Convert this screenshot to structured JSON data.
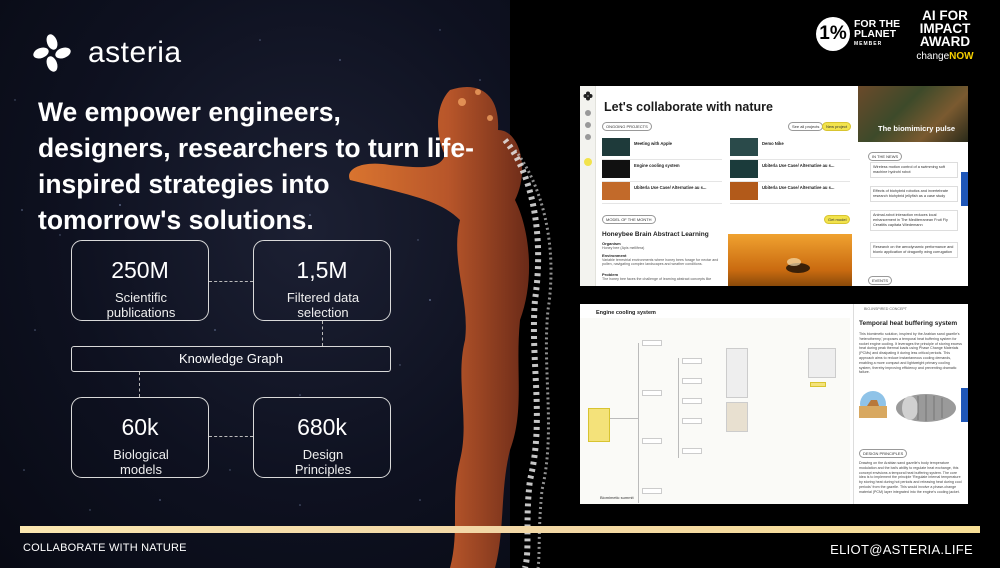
{
  "brand": {
    "name": "asteria"
  },
  "headline": "We empower engineers, designers, researchers to turn life-inspired strategies into tomorrow's solutions.",
  "stats": [
    {
      "value": "250M",
      "label": "Scientific publications"
    },
    {
      "value": "1,5M",
      "label": "Filtered data selection"
    },
    {
      "value": "60k",
      "label": "Biological models"
    },
    {
      "value": "680k",
      "label": "Design Principles"
    }
  ],
  "knowledge_graph": "Knowledge Graph",
  "badges": {
    "one_percent": {
      "mark": "1%",
      "line1": "FOR THE",
      "line2": "PLANET",
      "member": "MEMBER"
    },
    "award": {
      "line1": "AI FOR",
      "line2": "IMPACT",
      "line3": "AWARD",
      "change": "change",
      "now": "NOW"
    }
  },
  "screenshot1": {
    "title": "Let's collaborate with nature",
    "section_projects": "ONGOING PROJECTS",
    "see_all": "See all projects",
    "new_project": "New project",
    "projects": [
      "Meeting with Apple",
      "Demo Nike",
      "Engine cooling system",
      "Ubiterla Use Case/ Alternative au s...",
      "Ubiterla Use Case/ Alternative au s...",
      "Ubiterla Use Case/ Alternative au s..."
    ],
    "pulse": "The biomimicry pulse",
    "section_model": "MODEL OF THE MONTH",
    "get_model": "Get model",
    "model_title": "Honeybee Brain Abstract Learning",
    "model_sections": [
      "Organism",
      "Environment",
      "Problem"
    ],
    "model_texts": [
      "Honey bee (Apis mellifera)",
      "Variable terrestrial environments where honey bees forage for nectar and pollen, navigating complex landscapes and weather conditions.",
      "The honey bee faces the challenge of learning abstract concepts like"
    ],
    "section_news": "IN THE NEWS",
    "news": [
      "Wireless motion control of a swimming soft machine hydrohl robot",
      "Effects of biohybrid robotics and invertebrate research biohybrid jellyfish as a case study",
      "Animal-robot interaction reduces local enhancement in The Mediterranean Fruit Fly Ceratitis capitata Wiedemann",
      "Research on the aerodynamic performance and bionic application of dragonfly wing corrugation"
    ],
    "section_events": "EVENTS"
  },
  "screenshot2": {
    "title": "Engine cooling system",
    "panel_tag": "BIO-INSPIRED CONCEPT",
    "panel_title": "Temporal heat buffering system",
    "panel_text": "This biomimetic solution, inspired by the Arabian sand gazelle's 'heterothermy,' proposes a temporal heat buffering system for rocket engine cooling. It leverages the principle of storing excess heat during peak thermal loads using Phase Change Materials (PCMs) and dissipating it during less critical periods. This approach aims to reduce instantaneous cooling demands, enabling a more compact and lightweight primary cooling system, thereby improving efficiency and preventing dramatic failure.",
    "section_design": "DESIGN PRINCIPLES",
    "design_text": "Drawing on the Arabian sand gazelle's body temperature modulation and the bat's ability to regulate heat exchange, this concept envisions a temporal heat buffering system. The core idea is to implement the principle 'Regulate internal temperature by storing heat during hot periods and releasing heat during cool periods' from the gazelle. This would involve a phase-change material (PCM) layer integrated into the engine's cooling jacket.",
    "bottom_label": "Biomimetic summit"
  },
  "footer": {
    "left": "COLLABORATE WITH NATURE",
    "right": "ELIOT@ASTERIA.LIFE"
  },
  "colors": {
    "accent_yellow": "#f2e34c",
    "footer_bar": "#f6dfa5",
    "feedback_blue": "#1e56b8"
  }
}
